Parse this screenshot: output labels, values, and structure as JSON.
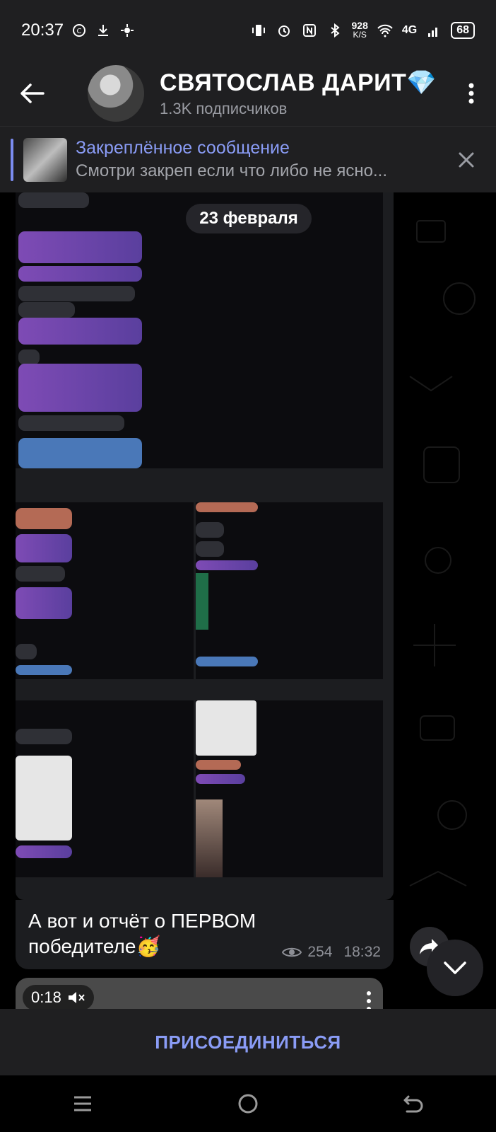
{
  "status_bar": {
    "time": "20:37",
    "net_speed": "928",
    "net_unit": "K/S",
    "network": "4G",
    "battery": "68"
  },
  "header": {
    "title": "СВЯТОСЛАВ ДАРИТ💎",
    "subscribers": "1.3K подписчиков"
  },
  "pinned": {
    "title": "Закреплённое сообщение",
    "text": "Смотри закреп если что либо не ясно..."
  },
  "chat": {
    "date_chip": "23 февраля",
    "album_caption": "А вот и отчёт о ПЕРВОМ победителе🥳",
    "views": "254",
    "time": "18:32",
    "next_video_duration": "0:18"
  },
  "join_button": "ПРИСОЕДИНИТЬСЯ",
  "colors": {
    "accent": "#8a9cf6",
    "header_bg": "#1f1f21",
    "bubble_bg": "#1c1d20"
  }
}
